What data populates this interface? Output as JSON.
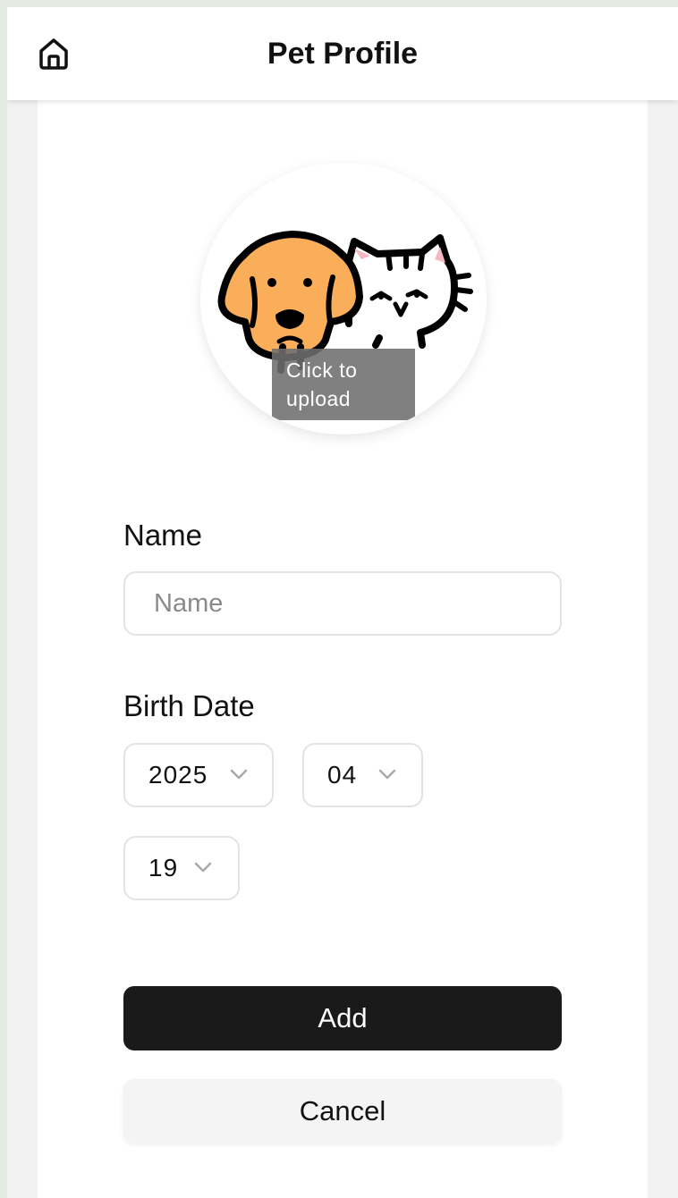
{
  "header": {
    "title": "Pet Profile",
    "home_icon": "home-icon"
  },
  "avatar": {
    "upload_hint": "Click to upload",
    "image_icon": "dog-and-cat-illustration"
  },
  "form": {
    "name_label": "Name",
    "name_value": "",
    "name_placeholder": "Name",
    "birth_date_label": "Birth Date",
    "year": "2025",
    "month": "04",
    "day": "19",
    "chevron_icon": "chevron-down-icon"
  },
  "actions": {
    "add_label": "Add",
    "cancel_label": "Cancel"
  },
  "colors": {
    "primary_button": "#1a1a1a",
    "secondary_button": "#f4f4f4",
    "dog_fur": "#fbae5a",
    "cat_ear_inner": "#f7b7c2"
  }
}
